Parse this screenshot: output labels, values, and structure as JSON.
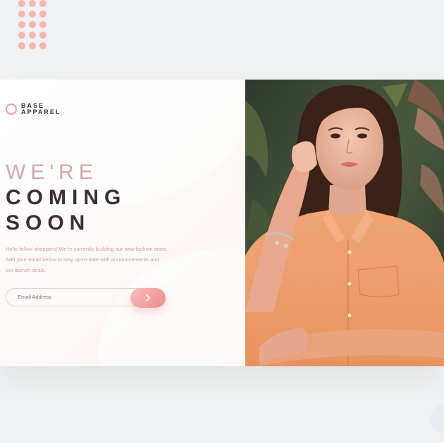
{
  "brand": {
    "line1": "BASE",
    "line2": "APPAREL"
  },
  "heading": {
    "light": "WE'RE",
    "dark1": "COMING",
    "dark2": "SOON"
  },
  "description": "Hello fellow shoppers! We're currently building our new fashion store. Add your email below to stay up-to-date with announcements and our launch deals.",
  "form": {
    "email_placeholder": "Email Address",
    "submit_icon": "chevron-right-icon"
  },
  "colors": {
    "accent": "#ee8b8b",
    "dark_text": "#3f2e36",
    "light_text": "#d6a8a8",
    "background": "#f0f1f2"
  }
}
